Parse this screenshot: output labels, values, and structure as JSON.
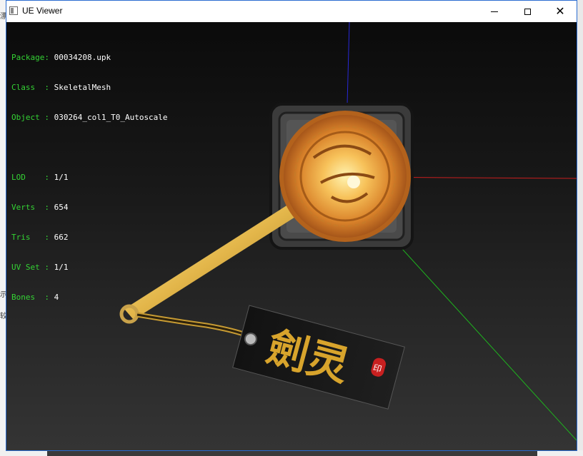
{
  "window": {
    "title": "UE Viewer",
    "controls": {
      "minimize": "minimize",
      "maximize": "maximize",
      "close": "close"
    }
  },
  "info": {
    "package": {
      "label": "Package: ",
      "value": "00034208.upk"
    },
    "class": {
      "label": "Class  : ",
      "value": "SkeletalMesh"
    },
    "object": {
      "label": "Object : ",
      "value": "030264_col1_T0_Autoscale"
    },
    "lod": {
      "label": "LOD    : ",
      "value": "1/1"
    },
    "verts": {
      "label": "Verts  : ",
      "value": "654"
    },
    "tris": {
      "label": "Tris   : ",
      "value": "662"
    },
    "uv_set": {
      "label": "UV Set : ",
      "value": "1/1"
    },
    "bones": {
      "label": "Bones  : ",
      "value": "4"
    }
  },
  "model": {
    "tag_calligraphy": "劍灵",
    "seal_glyph": "印"
  },
  "colors": {
    "label_green": "#34d334",
    "value_white": "#ffffff",
    "axis_x": "#c81e1e",
    "axis_y": "#1eb41e",
    "axis_z": "#2828d8",
    "gold": "#e0a93a"
  },
  "desktop": {
    "left_glyphs": [
      "漂",
      "示",
      "较"
    ]
  }
}
